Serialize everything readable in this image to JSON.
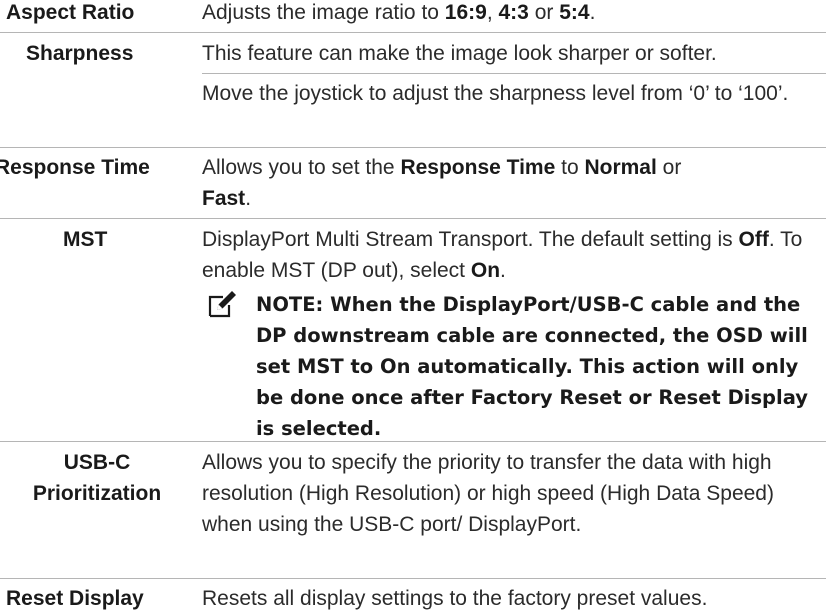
{
  "rows": [
    {
      "label": "Aspect Ratio",
      "desc_pre": "Adjusts the image ratio to ",
      "opt1": "16:9",
      "sep1": ", ",
      "opt2": "4:3",
      "sep2": " or ",
      "opt3": "5:4",
      "end": "."
    },
    {
      "label": "Sharpness",
      "p1": "This feature can make the image look sharper or softer.",
      "p2": "Move the joystick to adjust the sharpness level from ‘0’ to ‘100’."
    },
    {
      "label": "Response Time",
      "desc_pre": "Allows you to set the ",
      "b1": "Response Time",
      "mid": " to ",
      "b2": "Normal",
      "mid2": " or ",
      "b3": "Fast",
      "end": "."
    },
    {
      "label": "MST",
      "desc_pre": "DisplayPort Multi Stream Transport. The default setting is ",
      "b1": "Off",
      "mid": ". To enable MST (DP out), select ",
      "b2": "On",
      "end": ".",
      "note": "NOTE: When the DisplayPort/USB-C cable and the DP downstream cable are connected, the OSD will set MST to On automatically. This action will only be done once after Factory Reset or Reset Display is selected.",
      "note_icon": "pencil-note-icon"
    },
    {
      "label_line1": "USB-C",
      "label_line2": "Prioritization",
      "desc": "Allows you to specify the priority to transfer the data with high resolution (High Resolution) or high speed (High Data Speed) when using the USB-C port/ DisplayPort."
    },
    {
      "label": "Reset Display",
      "desc": "Resets all display settings to the factory preset values."
    }
  ],
  "colors": {
    "text": "#1a1a1a",
    "rule": "#b5b5b5"
  }
}
